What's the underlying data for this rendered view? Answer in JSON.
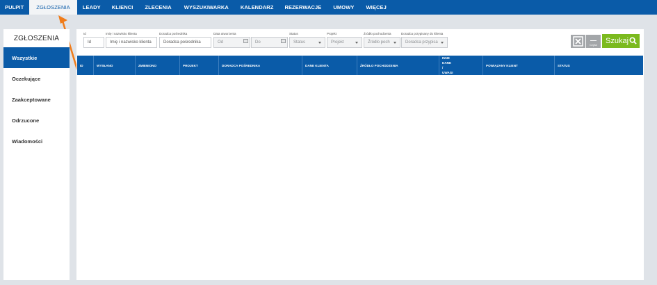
{
  "nav": {
    "items": [
      {
        "label": "PULPIT",
        "active": false
      },
      {
        "label": "ZGŁOSZENIA",
        "active": true
      },
      {
        "label": "LEADY",
        "active": false
      },
      {
        "label": "KLIENCI",
        "active": false
      },
      {
        "label": "ZLECENIA",
        "active": false
      },
      {
        "label": "WYSZUKIWARKA",
        "active": false
      },
      {
        "label": "KALENDARZ",
        "active": false
      },
      {
        "label": "REZERWACJE",
        "active": false
      },
      {
        "label": "UMOWY",
        "active": false
      },
      {
        "label": "WIĘCEJ",
        "active": false
      }
    ]
  },
  "sidebar": {
    "title": "ZGŁOSZENIA",
    "items": [
      {
        "label": "Wszystkie",
        "active": true
      },
      {
        "label": "Oczekujące",
        "active": false
      },
      {
        "label": "Zaakceptowane",
        "active": false
      },
      {
        "label": "Odrzucone",
        "active": false
      },
      {
        "label": "Wiadomości",
        "active": false
      }
    ]
  },
  "filters": {
    "id": {
      "label": "Id",
      "placeholder": "Id"
    },
    "name": {
      "label": "Imię i nazwisko klienta",
      "placeholder": "Imię i nazwisko klienta"
    },
    "advisor": {
      "label": "Doradca pośrednika",
      "placeholder": "Doradca pośrednika"
    },
    "created": {
      "label": "Data utworzenia",
      "from": "Od",
      "to": "Do"
    },
    "status": {
      "label": "Status",
      "value": "Status"
    },
    "project": {
      "label": "Projekt",
      "value": "Projekt"
    },
    "source": {
      "label": "Źródło pochodzenia",
      "value": "Źródło poch"
    },
    "assigned": {
      "label": "Doradca przypisany do klienta",
      "value": "Doradca przypisa"
    }
  },
  "buttons": {
    "clear_label": "Czyść",
    "search_label": "Szukaj"
  },
  "table": {
    "columns": [
      "ID",
      "WYSŁANO",
      "ZMIENIONO",
      "PROJEKT",
      "DORADCA POŚREDNIKA",
      "DANE KLIENTA",
      "ŹRÓDŁO POCHODZENIA",
      "INNE DANE / UWAGI",
      "POWIĄZANY KLIENT",
      "STATUS"
    ],
    "rows": []
  },
  "colors": {
    "nav_blue": "#0a5ba8",
    "search_green": "#7bba1e",
    "arrow_orange": "#f07c1a"
  }
}
